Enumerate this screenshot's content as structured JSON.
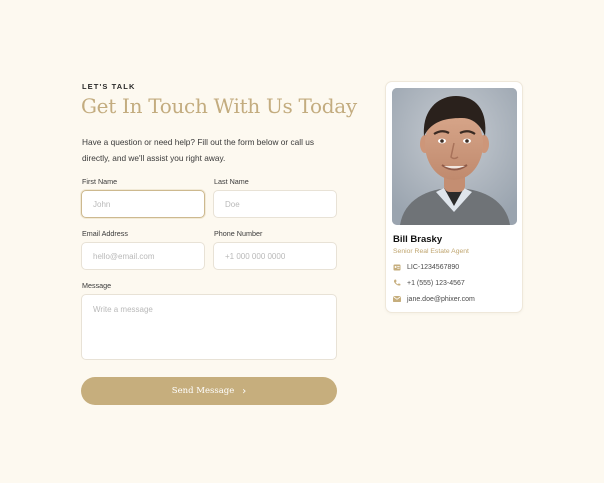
{
  "header": {
    "eyebrow": "LET'S TALK",
    "title": "Get In Touch With Us Today",
    "intro": "Have a question or need help? Fill out the form below or call us directly, and we'll assist you right away."
  },
  "form": {
    "first_name": {
      "label": "First Name",
      "placeholder": "John"
    },
    "last_name": {
      "label": "Last Name",
      "placeholder": "Doe"
    },
    "email": {
      "label": "Email Address",
      "placeholder": "hello@email.com"
    },
    "phone": {
      "label": "Phone Number",
      "placeholder": "+1 000 000 0000"
    },
    "message": {
      "label": "Message",
      "placeholder": "Write a message"
    },
    "submit_label": "Send Message"
  },
  "agent": {
    "name": "Bill Brasky",
    "title": "Senior Real Estate Agent",
    "license": "LIC-1234567890",
    "phone": "+1 (555) 123-4567",
    "email": "jane.doe@phixer.com"
  },
  "icons": {
    "license": "id-card-icon",
    "phone": "phone-icon",
    "email": "mail-icon",
    "submit": "chevron-right-icon"
  },
  "colors": {
    "background": "#fdf9f0",
    "accent": "#c6ae7d",
    "heading": "#c3ac7f"
  }
}
